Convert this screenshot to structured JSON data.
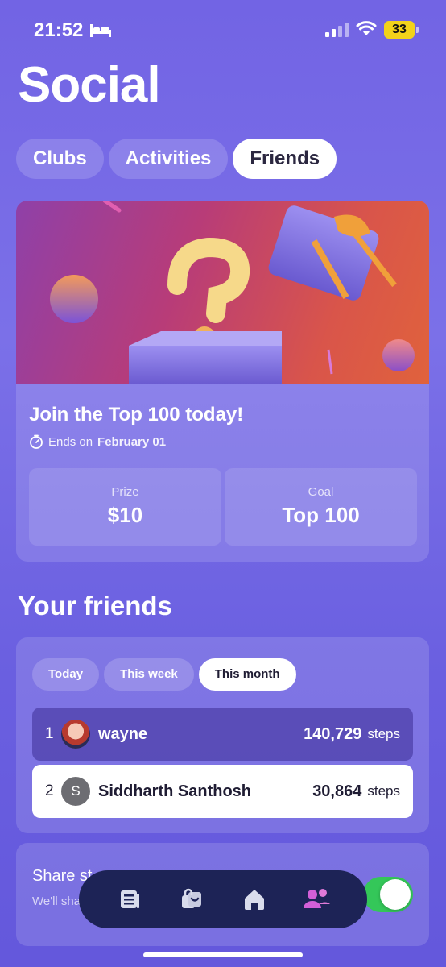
{
  "status_bar": {
    "time": "21:52",
    "battery": "33"
  },
  "page": {
    "title": "Social"
  },
  "tabs": [
    {
      "label": "Clubs"
    },
    {
      "label": "Activities"
    },
    {
      "label": "Friends"
    }
  ],
  "promo": {
    "title": "Join the Top 100 today!",
    "ends_prefix": "Ends on",
    "ends_date": "February 01",
    "prize_label": "Prize",
    "prize_value": "$10",
    "goal_label": "Goal",
    "goal_value": "Top 100"
  },
  "friends": {
    "title": "Your friends",
    "periods": [
      {
        "label": "Today"
      },
      {
        "label": "This week"
      },
      {
        "label": "This month"
      }
    ],
    "rows": [
      {
        "rank": "1",
        "name": "wayne",
        "steps": "140,729",
        "unit": "steps"
      },
      {
        "rank": "2",
        "initial": "S",
        "name": "Siddharth Santhosh",
        "steps": "30,864",
        "unit": "steps"
      }
    ]
  },
  "share": {
    "title": "Share st",
    "description": "We'll sha follow yo",
    "enabled": true
  },
  "tabbar": {
    "items": [
      {
        "icon": "feed-icon"
      },
      {
        "icon": "shop-icon"
      },
      {
        "icon": "home-icon"
      },
      {
        "icon": "social-icon"
      }
    ]
  },
  "colors": {
    "accent_green": "#34c759",
    "tabbar_bg": "#1d2356",
    "active_tab_icon": "#d35fd8"
  }
}
